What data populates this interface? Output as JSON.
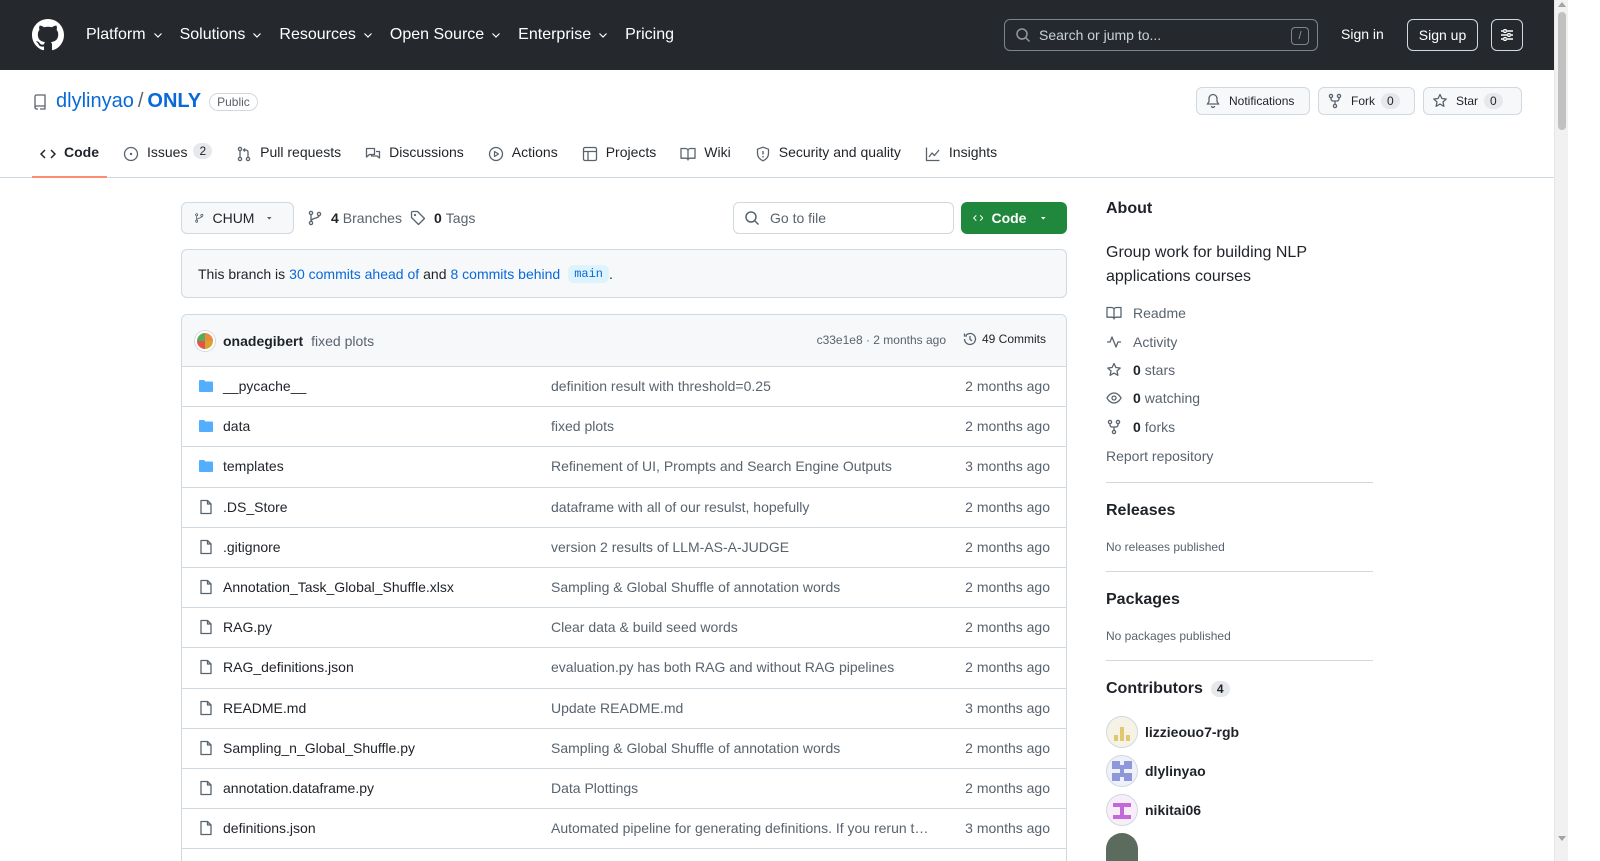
{
  "header": {
    "nav": [
      "Platform",
      "Solutions",
      "Resources",
      "Open Source",
      "Enterprise",
      "Pricing"
    ],
    "search_placeholder": "Search or jump to...",
    "search_shortcut": "/",
    "signin": "Sign in",
    "signup": "Sign up"
  },
  "repo": {
    "owner": "dlylinyao",
    "separator": "/",
    "name": "ONLY",
    "visibility": "Public",
    "notifications_label": "Notifications",
    "fork_label": "Fork",
    "fork_count": "0",
    "star_label": "Star",
    "star_count": "0"
  },
  "tabs": {
    "code": "Code",
    "issues": "Issues",
    "issues_count": "2",
    "pulls": "Pull requests",
    "discussions": "Discussions",
    "actions": "Actions",
    "projects": "Projects",
    "wiki": "Wiki",
    "security": "Security and quality",
    "insights": "Insights"
  },
  "toolbar": {
    "branch": "CHUM",
    "branches_count": "4",
    "branches_label": "Branches",
    "tags_count": "0",
    "tags_label": "Tags",
    "goto_placeholder": "Go to file",
    "code_button": "Code"
  },
  "branch_status": {
    "prefix": "This branch is",
    "ahead": "30 commits ahead of",
    "middle": "and",
    "behind": "8 commits behind",
    "base": "main",
    "suffix": "."
  },
  "latest_commit": {
    "author": "onadegibert",
    "message": "fixed plots",
    "meta": "c33e1e8 · 2 months ago",
    "count_label": "49 Commits"
  },
  "files": [
    {
      "type": "dir",
      "name": "__pycache__",
      "message": "definition result with threshold=0.25",
      "date": "2 months ago"
    },
    {
      "type": "dir",
      "name": "data",
      "message": "fixed plots",
      "date": "2 months ago"
    },
    {
      "type": "dir",
      "name": "templates",
      "message": "Refinement of UI, Prompts and Search Engine Outputs",
      "date": "3 months ago"
    },
    {
      "type": "file",
      "name": ".DS_Store",
      "message": "dataframe with all of our resulst, hopefully",
      "date": "2 months ago"
    },
    {
      "type": "file",
      "name": ".gitignore",
      "message": "version 2 results of LLM-AS-A-JUDGE",
      "date": "2 months ago"
    },
    {
      "type": "file",
      "name": "Annotation_Task_Global_Shuffle.xlsx",
      "message": "Sampling & Global Shuffle of annotation words",
      "date": "2 months ago"
    },
    {
      "type": "file",
      "name": "RAG.py",
      "message": "Clear data & build seed words",
      "date": "2 months ago"
    },
    {
      "type": "file",
      "name": "RAG_definitions.json",
      "message": "evaluation.py has both RAG and without RAG pipelines",
      "date": "2 months ago"
    },
    {
      "type": "file",
      "name": "README.md",
      "message": "Update README.md",
      "date": "3 months ago"
    },
    {
      "type": "file",
      "name": "Sampling_n_Global_Shuffle.py",
      "message": "Sampling & Global Shuffle of annotation words",
      "date": "2 months ago"
    },
    {
      "type": "file",
      "name": "annotation.dataframe.py",
      "message": "Data Plottings",
      "date": "2 months ago"
    },
    {
      "type": "file",
      "name": "definitions.json",
      "message": "Automated pipeline for generating definitions. If you rerun thi…",
      "date": "3 months ago"
    }
  ],
  "sidebar": {
    "about_title": "About",
    "description": "Group work for building NLP applications courses",
    "readme": "Readme",
    "activity": "Activity",
    "stars_count": "0",
    "stars_label": "stars",
    "watching_count": "0",
    "watching_label": "watching",
    "forks_count": "0",
    "forks_label": "forks",
    "report": "Report repository",
    "releases_title": "Releases",
    "releases_empty": "No releases published",
    "packages_title": "Packages",
    "packages_empty": "No packages published",
    "contributors_title": "Contributors",
    "contributors_count": "4",
    "contributors": [
      "lizzieouo7-rgb",
      "dlylinyao",
      "nikitai06"
    ]
  },
  "colors": {
    "header_bg": "#25292e",
    "link": "#0969da",
    "primary_button": "#1f883d",
    "active_tab_underline": "#fd8c73",
    "folder_icon": "#54aeff"
  },
  "icons": [
    "github-logo-icon",
    "chevron-down-icon",
    "search-icon",
    "hamburger-icon",
    "repo-icon",
    "bell-icon",
    "fork-icon",
    "star-icon",
    "code-icon",
    "issue-icon",
    "pull-request-icon",
    "discussion-icon",
    "play-icon",
    "table-icon",
    "book-icon",
    "shield-icon",
    "graph-icon",
    "branch-icon",
    "tag-icon",
    "history-icon",
    "folder-icon",
    "file-icon",
    "pulse-icon",
    "eye-icon"
  ]
}
